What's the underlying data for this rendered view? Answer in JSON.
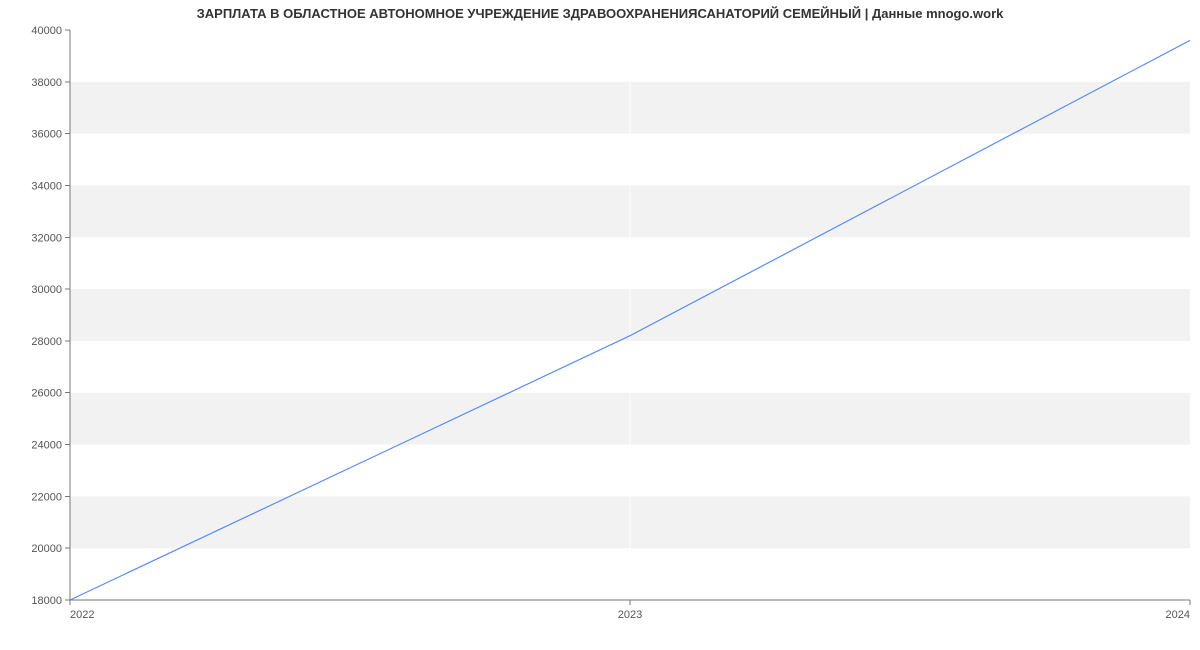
{
  "chart_data": {
    "type": "line",
    "title": "ЗАРПЛАТА В ОБЛАСТНОЕ АВТОНОМНОЕ УЧРЕЖДЕНИЕ ЗДРАВООХРАНЕНИЯСАНАТОРИЙ СЕМЕЙНЫЙ | Данные mnogo.work",
    "x": [
      2022,
      2023,
      2024
    ],
    "values": [
      18000,
      28200,
      39600
    ],
    "x_ticks": [
      "2022",
      "2023",
      "2024"
    ],
    "y_ticks": [
      18000,
      20000,
      22000,
      24000,
      26000,
      28000,
      30000,
      32000,
      34000,
      36000,
      38000,
      40000
    ],
    "xlabel": "",
    "ylabel": "",
    "xlim": [
      2022,
      2024
    ],
    "ylim": [
      18000,
      40000
    ]
  }
}
